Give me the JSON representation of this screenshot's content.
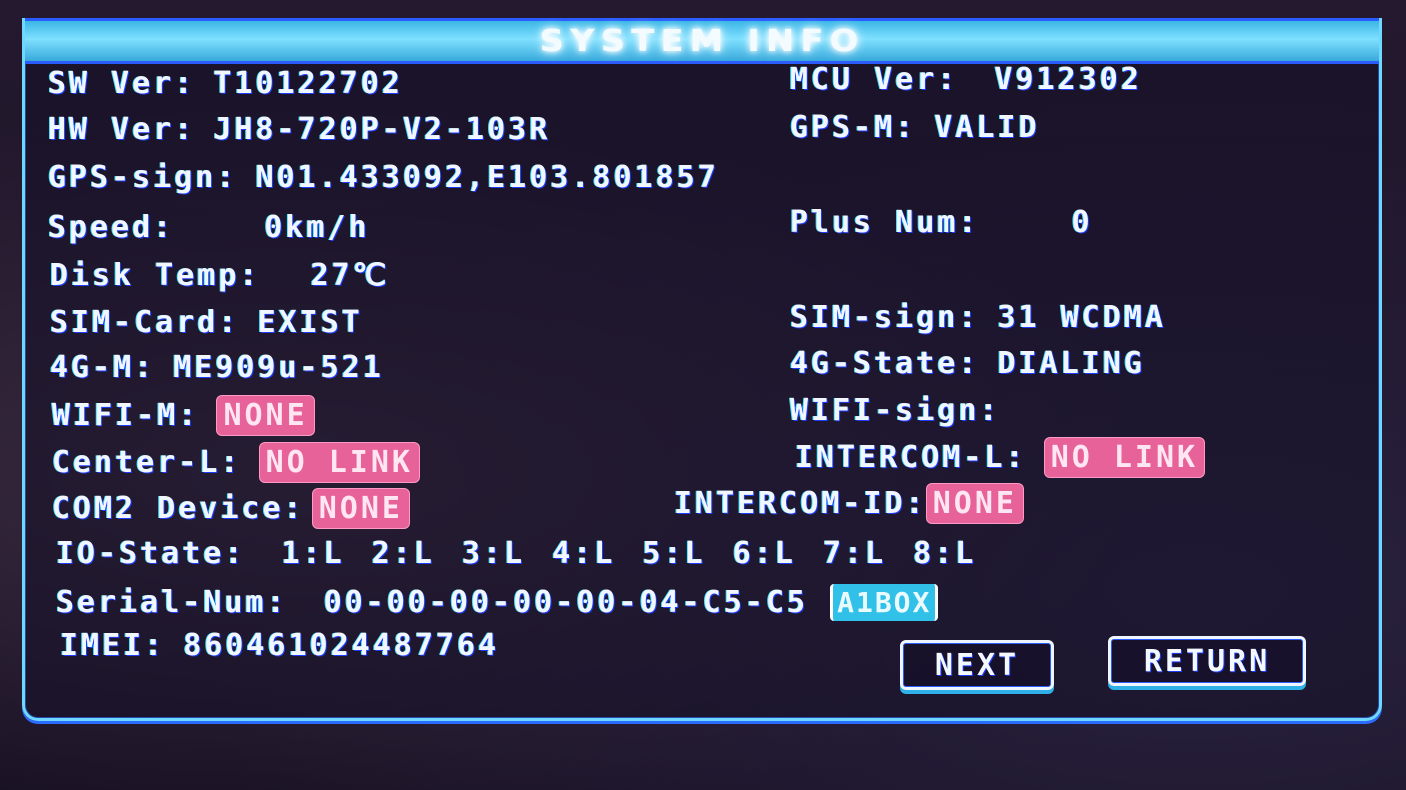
{
  "window": {
    "title": "SYSTEM INFO"
  },
  "left": {
    "sw_ver": {
      "label": "SW Ver:",
      "value": "T10122702"
    },
    "hw_ver": {
      "label": "HW Ver:",
      "value": "JH8-720P-V2-103R"
    },
    "gps_sign": {
      "label": "GPS-sign:",
      "value": "N01.433092,E103.801857"
    },
    "speed": {
      "label": "Speed:",
      "value": "0km/h"
    },
    "disk_temp": {
      "label": "Disk Temp:",
      "value": "27℃"
    },
    "sim_card": {
      "label": "SIM-Card:",
      "value": "EXIST"
    },
    "g4_module": {
      "label": "4G-M:",
      "value": "ME909u-521"
    },
    "wifi_module": {
      "label": "WIFI-M:",
      "value": "NONE"
    },
    "center_link": {
      "label": "Center-L:",
      "value": "NO LINK"
    },
    "com2_device": {
      "label": "COM2 Device:",
      "value": "NONE"
    },
    "io_state": {
      "label": "IO-State:",
      "value": "1:L 2:L 3:L 4:L 5:L 6:L 7:L 8:L"
    },
    "serial_num": {
      "label": "Serial-Num:",
      "value": "00-00-00-00-00-04-C5-C5",
      "tag": "A1BOX"
    },
    "imei": {
      "label": "IMEI:",
      "value": "860461024487764"
    }
  },
  "right": {
    "mcu_ver": {
      "label": "MCU Ver:",
      "value": "V912302"
    },
    "gps_module": {
      "label": "GPS-M:",
      "value": "VALID"
    },
    "plus_num": {
      "label": "Plus Num:",
      "value": "0"
    },
    "sim_sign": {
      "label": "SIM-sign:",
      "value": "31 WCDMA"
    },
    "g4_state": {
      "label": "4G-State:",
      "value": "DIALING"
    },
    "wifi_sign": {
      "label": "WIFI-sign:",
      "value": ""
    },
    "intercom_link": {
      "label": "INTERCOM-L:",
      "value": "NO LINK"
    },
    "intercom_id": {
      "label": "INTERCOM-ID:",
      "value": "NONE"
    }
  },
  "buttons": {
    "next": "NEXT",
    "return": "RETURN"
  },
  "colors": {
    "accent": "#6fd8ff",
    "warning_badge": "#e8629a",
    "highlight_badge": "#31c0e8"
  }
}
